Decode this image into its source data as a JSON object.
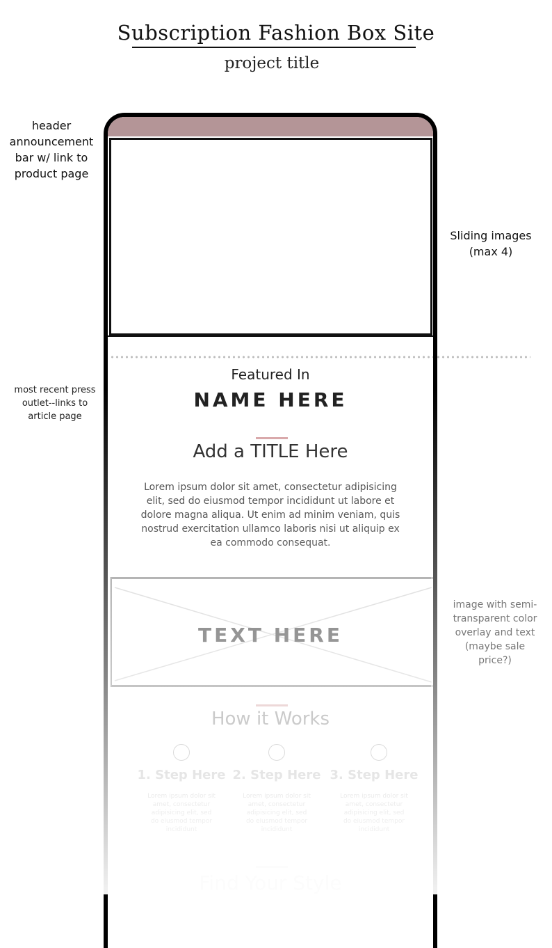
{
  "header": {
    "title": "Subscription Fashion Box Site",
    "subtitle": "project title"
  },
  "annotations": {
    "header_bar": [
      "header",
      "announcement",
      "bar w/ link to",
      "product page"
    ],
    "sliding": [
      "Sliding images",
      "(max 4)"
    ],
    "press": [
      "most recent press",
      "outlet--links to",
      "article page"
    ],
    "overlay": [
      "image with semi-",
      "transparent color",
      "overlay and text",
      "(maybe sale",
      "price?)"
    ]
  },
  "mockup": {
    "featured_label": "Featured In",
    "featured_name": "NAME HERE",
    "section_title": "Add a TITLE Here",
    "body_text": "Lorem ipsum dolor sit amet, consectetur adipisicing elit, sed do eiusmod tempor incididunt ut labore et dolore magna aliqua. Ut enim ad minim veniam, quis nostrud exercitation ullamco laboris nisi ut aliquip ex ea commodo consequat.",
    "overlay_text": "TEXT HERE",
    "how_title": "How it Works",
    "steps": [
      {
        "label": "1. Step Here",
        "text": "Lorem ipsum dolor sit amet, consectetur adipisicing elit, sed do eiusmod tempor incididunt"
      },
      {
        "label": "2. Step Here",
        "text": "Lorem ipsum dolor sit amet, consectetur adipisicing elit, sed do eiusmod tempor incididunt"
      },
      {
        "label": "3. Step Here",
        "text": "Lorem ipsum dolor sit amet, consectetur adipisicing elit, sed do eiusmod tempor incididunt"
      }
    ],
    "find_title": "Find Your Style"
  },
  "colors": {
    "announcement_bar": "#b49597",
    "accent_rule": "#d9a9ab"
  }
}
